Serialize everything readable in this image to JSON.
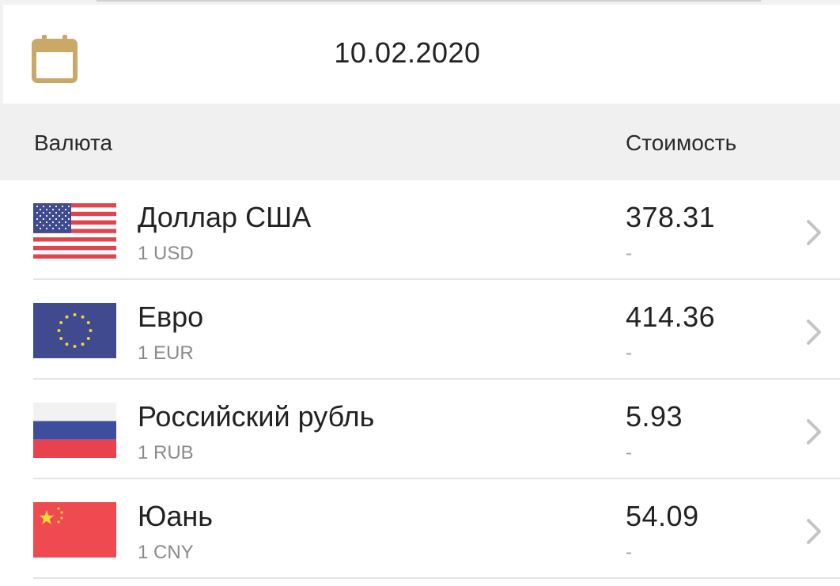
{
  "date_bar": {
    "icon": "calendar-icon",
    "date": "10.02.2020"
  },
  "table_header": {
    "currency": "Валюта",
    "value": "Стоимость"
  },
  "rows": [
    {
      "flag": "us-flag-icon",
      "name": "Доллар США",
      "code": "1 USD",
      "value": "378.31",
      "change": "-"
    },
    {
      "flag": "eu-flag-icon",
      "name": "Евро",
      "code": "1 EUR",
      "value": "414.36",
      "change": "-"
    },
    {
      "flag": "ru-flag-icon",
      "name": "Российский рубль",
      "code": "1 RUB",
      "value": "5.93",
      "change": "-"
    },
    {
      "flag": "cn-flag-icon",
      "name": "Юань",
      "code": "1 CNY",
      "value": "54.09",
      "change": "-"
    }
  ],
  "colors": {
    "accent": "#c9a868",
    "header_bg": "#f0f0f0",
    "text": "#222222",
    "secondary_text": "#8a8a8a"
  }
}
